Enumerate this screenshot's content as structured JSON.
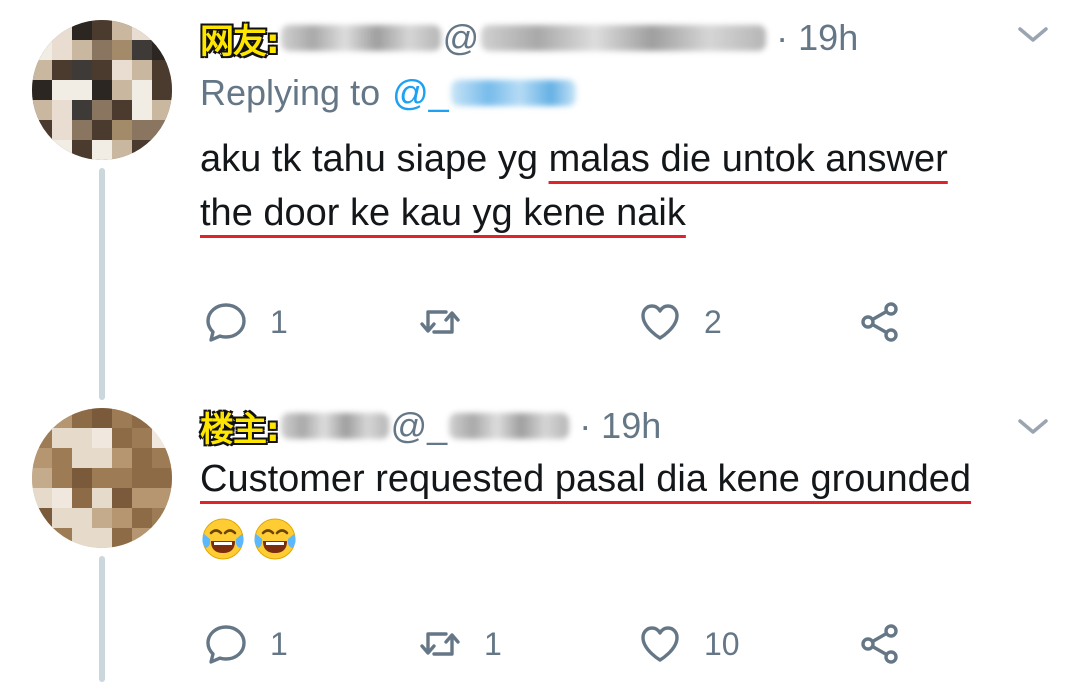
{
  "tweets": [
    {
      "badge": "网友:",
      "at": "@",
      "time": "· 19h",
      "replying_prefix": "Replying to",
      "replying_at": "@_",
      "text_plain": "aku tk tahu siape yg ",
      "text_underlined_1": "malas die untok answer",
      "text_underlined_2": "the door ke kau yg kene naik",
      "replies": "1",
      "retweets": "",
      "likes": "2"
    },
    {
      "badge": "楼主:",
      "at": "@_",
      "time": "· 19h",
      "text_underlined_1": "Customer requested pasal dia kene grounded",
      "emoji": [
        "face-with-tears-of-joy",
        "face-with-tears-of-joy"
      ],
      "replies": "1",
      "retweets": "1",
      "likes": "10"
    }
  ],
  "colors": {
    "text": "#14171a",
    "muted": "#657786",
    "link": "#1da1f2",
    "underline": "#e0222a",
    "badge": "#ffe600",
    "thread": "#ccd6dd"
  }
}
